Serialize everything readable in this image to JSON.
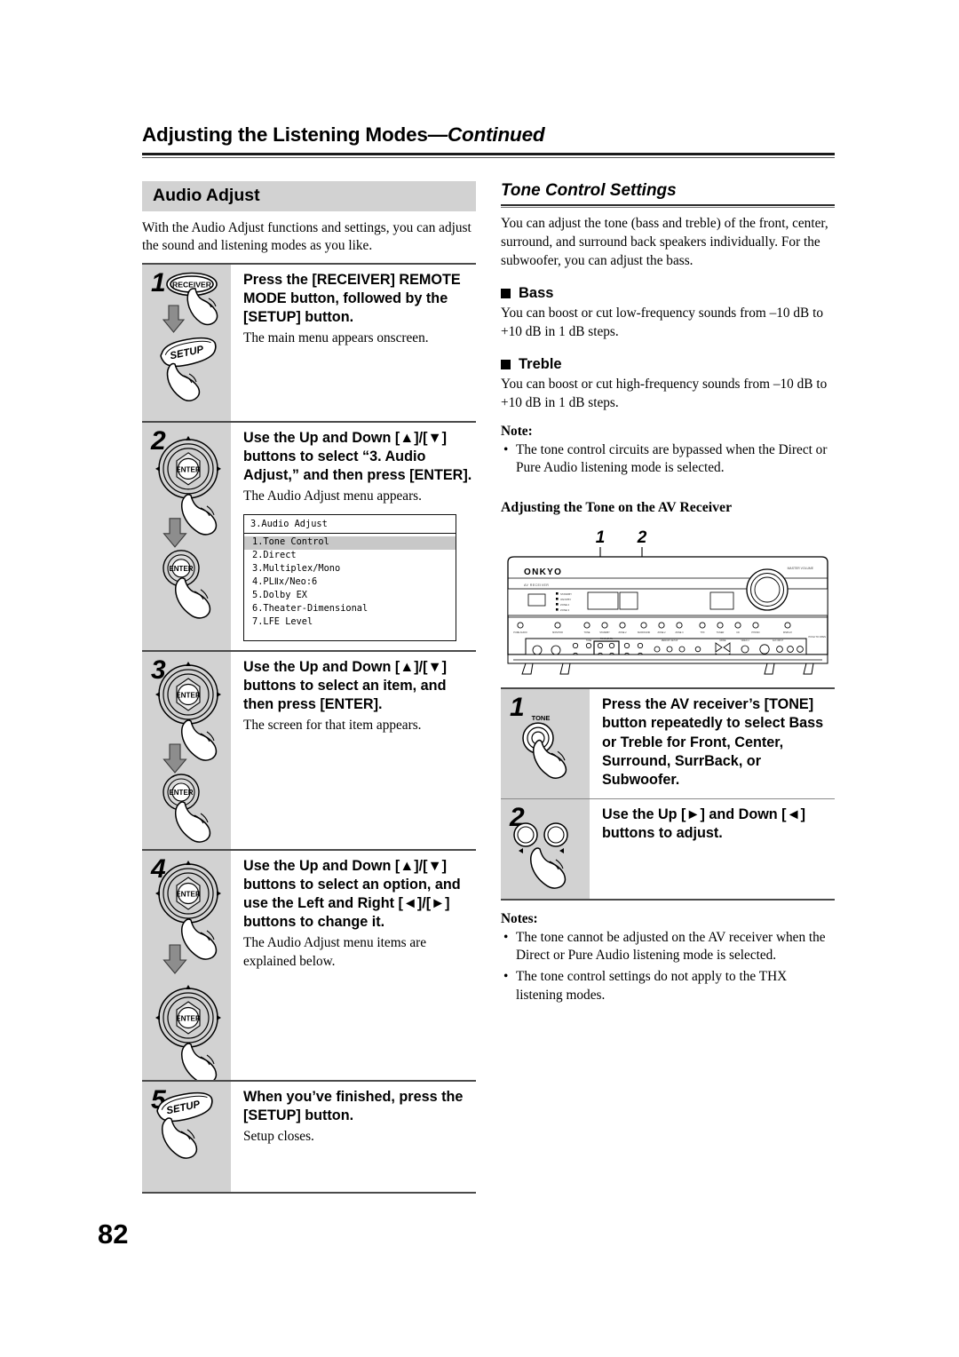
{
  "running_head": {
    "title": "Adjusting the Listening Modes",
    "continued": "—Continued"
  },
  "page_number": "82",
  "left_column": {
    "section_title": "Audio Adjust",
    "intro": "With the Audio Adjust functions and settings, you can adjust the sound and listening modes as you like.",
    "steps": [
      {
        "number": "1",
        "bold": "Press the [RECEIVER] REMOTE MODE button, followed by the [SETUP] button.",
        "plain": "The main menu appears onscreen.",
        "art": "remote-receiver-then-setup",
        "button_labels": [
          "RECEIVER",
          "SETUP"
        ]
      },
      {
        "number": "2",
        "bold": "Use the Up and Down [▲]/[▼] buttons to select “3. Audio Adjust,” and then press [ENTER].",
        "plain": "The Audio Adjust menu appears.",
        "art": "remote-dpad-then-enter",
        "button_labels": [
          "ENTER",
          "ENTER"
        ]
      },
      {
        "number": "3",
        "bold": "Use the Up and Down [▲]/[▼] buttons to select an item, and then press [ENTER].",
        "plain": "The screen for that item appears.",
        "art": "remote-dpad-then-enter",
        "button_labels": [
          "ENTER",
          "ENTER"
        ]
      },
      {
        "number": "4",
        "bold": "Use the Up and Down [▲]/[▼] buttons to select an option, and use the Left and Right [◄]/[►] buttons to change it.",
        "plain": "The Audio Adjust menu items are explained below.",
        "art": "remote-dpad-then-dpad",
        "button_labels": [
          "ENTER",
          "ENTER"
        ]
      },
      {
        "number": "5",
        "bold": "When you’ve finished, press the [SETUP] button.",
        "plain": "Setup closes.",
        "art": "remote-setup",
        "button_labels": [
          "SETUP"
        ]
      }
    ],
    "osd_menu": {
      "title": "3.Audio Adjust",
      "items": [
        "1.Tone Control",
        "2.Direct",
        "3.Multiplex/Mono",
        "4.PLⅡx/Neo:6",
        "5.Dolby EX",
        "6.Theater-Dimensional",
        "7.LFE Level"
      ],
      "selected_index": 0
    }
  },
  "right_column": {
    "section_title": "Tone Control Settings",
    "intro": "You can adjust the tone (bass and treble) of the front, center, surround, and surround back speakers individually. For the subwoofer, you can adjust the bass.",
    "bass": {
      "heading": "Bass",
      "text": "You can boost or cut low-frequency sounds from –10 dB to +10 dB in 1 dB steps."
    },
    "treble": {
      "heading": "Treble",
      "text": "You can boost or cut high-frequency sounds from –10 dB to +10 dB in 1 dB steps."
    },
    "note_label": "Note:",
    "notes": [
      "The tone control circuits are bypassed when the Direct or Pure Audio listening mode is selected."
    ],
    "receiver_section_title": "Adjusting the Tone on the AV Receiver",
    "receiver_diagram": {
      "brand": "ONKYO",
      "callouts": [
        "1",
        "2"
      ],
      "front_panel_marks": [
        "TONE",
        "TONE LEVEL"
      ]
    },
    "steps": [
      {
        "number": "1",
        "bold": "Press the AV receiver’s [TONE] button repeatedly to select Bass or Treble for Front, Center, Surround, SurrBack, or Subwoofer.",
        "art": "receiver-tone-button",
        "button_label": "TONE"
      },
      {
        "number": "2",
        "bold": "Use the Up [►] and Down [◄] buttons to adjust.",
        "art": "receiver-two-buttons",
        "button_label": ""
      }
    ],
    "notes_label": "Notes:",
    "notes_bottom": [
      "The tone cannot be adjusted on the AV receiver when the Direct or Pure Audio listening mode is selected.",
      "The tone control settings do not apply to the THX listening modes."
    ]
  },
  "colors": {
    "band_gray": "#d2d2d2",
    "rule_dark": "#4a4a4a",
    "osd_selected": "#c8c8c8"
  }
}
